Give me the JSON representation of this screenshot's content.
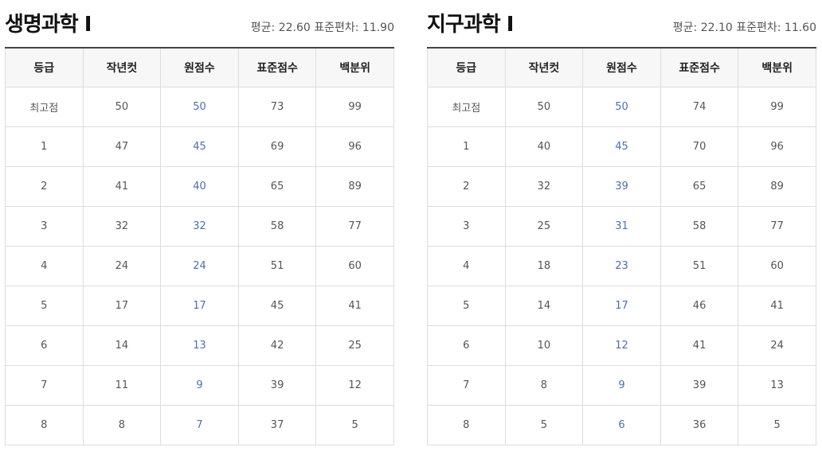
{
  "columns": [
    "등급",
    "작년컷",
    "원점수",
    "표준점수",
    "백분위"
  ],
  "left": {
    "title": "생명과학 Ⅰ",
    "stats_text": "평균: 22.60 표준편차: 11.90",
    "rows": [
      [
        "최고점",
        "50",
        "50",
        "73",
        "99"
      ],
      [
        "1",
        "47",
        "45",
        "69",
        "96"
      ],
      [
        "2",
        "41",
        "40",
        "65",
        "89"
      ],
      [
        "3",
        "32",
        "32",
        "58",
        "77"
      ],
      [
        "4",
        "24",
        "24",
        "51",
        "60"
      ],
      [
        "5",
        "17",
        "17",
        "45",
        "41"
      ],
      [
        "6",
        "14",
        "13",
        "42",
        "25"
      ],
      [
        "7",
        "11",
        "9",
        "39",
        "12"
      ],
      [
        "8",
        "8",
        "7",
        "37",
        "5"
      ]
    ]
  },
  "right": {
    "title": "지구과학 Ⅰ",
    "stats_text": "평균: 22.10 표준편차: 11.60",
    "rows": [
      [
        "최고점",
        "50",
        "50",
        "74",
        "99"
      ],
      [
        "1",
        "40",
        "45",
        "70",
        "96"
      ],
      [
        "2",
        "32",
        "39",
        "65",
        "89"
      ],
      [
        "3",
        "25",
        "31",
        "58",
        "77"
      ],
      [
        "4",
        "18",
        "23",
        "51",
        "60"
      ],
      [
        "5",
        "14",
        "17",
        "46",
        "41"
      ],
      [
        "6",
        "10",
        "12",
        "41",
        "24"
      ],
      [
        "7",
        "8",
        "9",
        "39",
        "13"
      ],
      [
        "8",
        "5",
        "6",
        "36",
        "5"
      ]
    ]
  },
  "colors": {
    "raw_score": "#4a6fb5",
    "header_bg": "#f7f7f7",
    "border": "#dddddd",
    "top_border": "#444444"
  }
}
